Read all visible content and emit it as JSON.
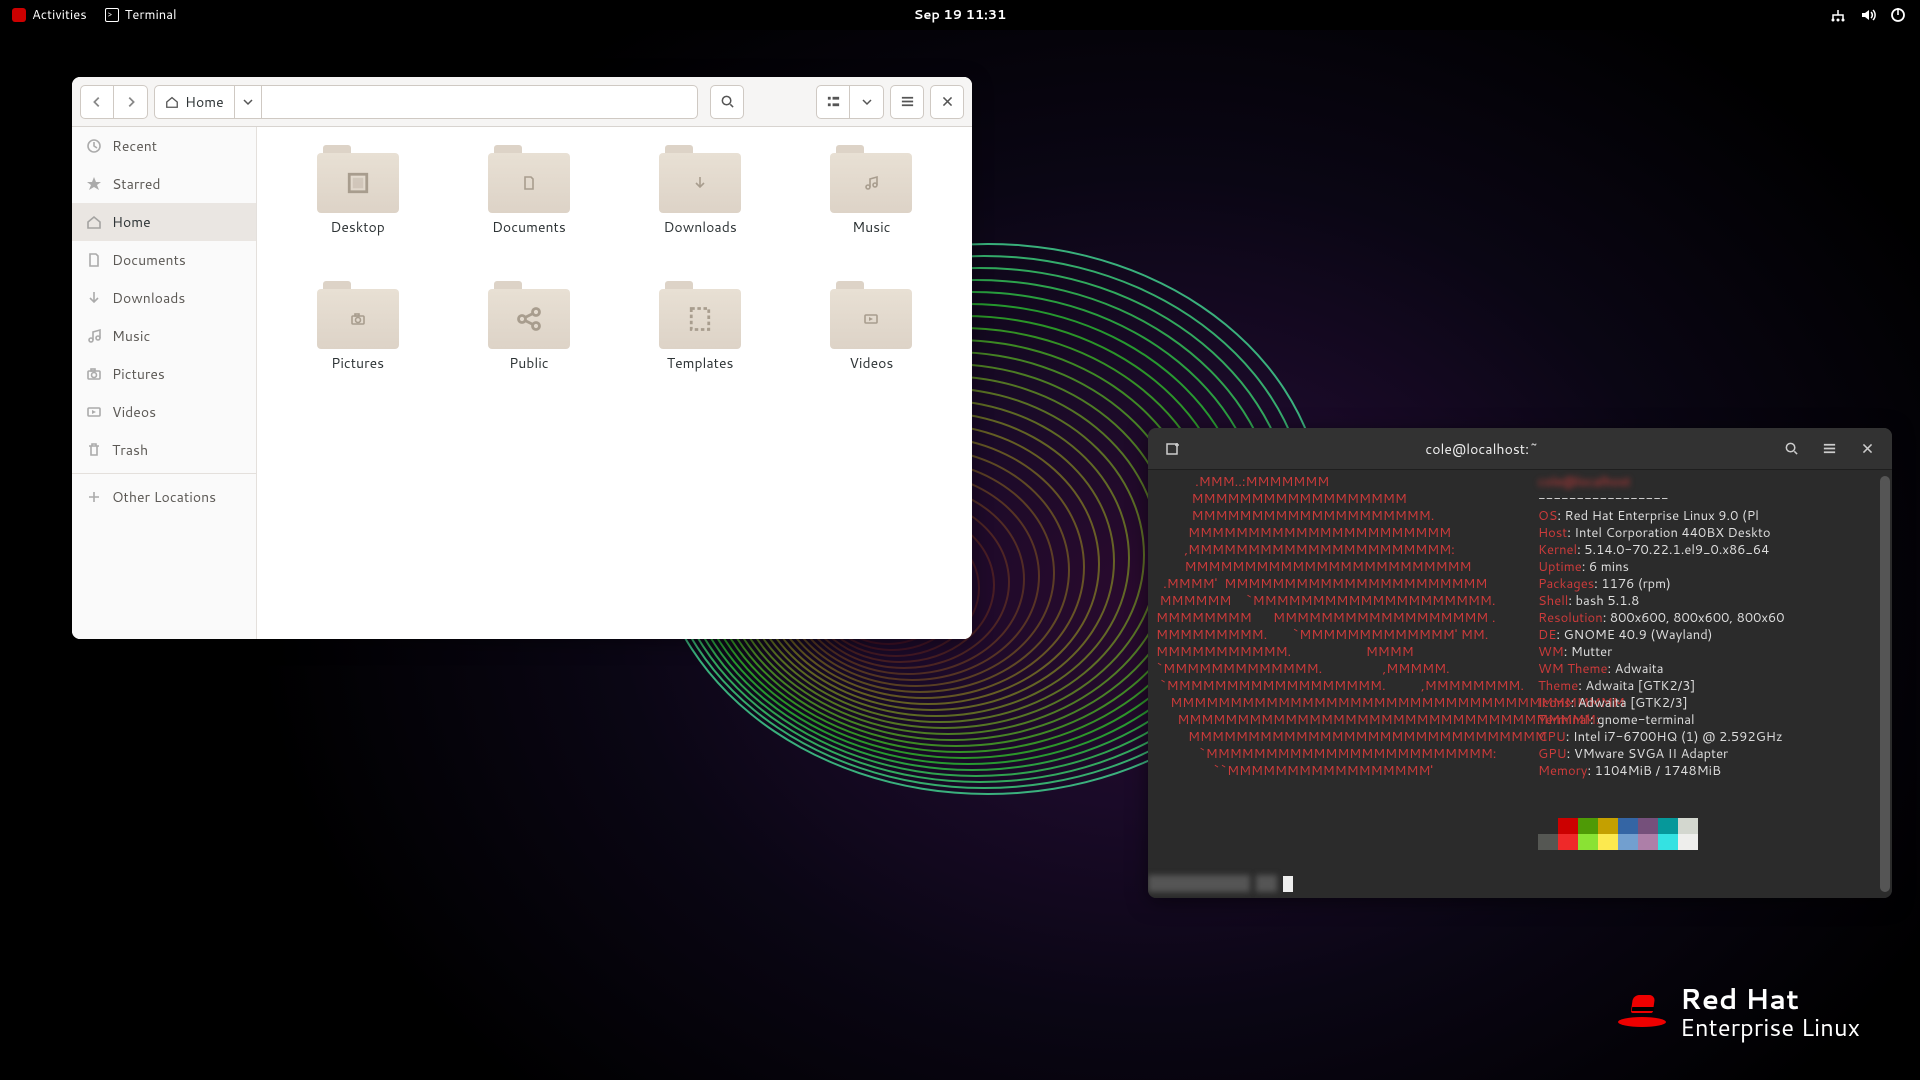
{
  "topbar": {
    "activities": "Activities",
    "terminal_label": "Terminal",
    "datetime": "Sep 19  11:31"
  },
  "files": {
    "path_label": "Home",
    "sidebar": [
      {
        "label": "Recent",
        "icon": "clock"
      },
      {
        "label": "Starred",
        "icon": "star"
      },
      {
        "label": "Home",
        "icon": "home",
        "active": true
      },
      {
        "label": "Documents",
        "icon": "doc"
      },
      {
        "label": "Downloads",
        "icon": "down"
      },
      {
        "label": "Music",
        "icon": "music"
      },
      {
        "label": "Pictures",
        "icon": "camera"
      },
      {
        "label": "Videos",
        "icon": "video"
      },
      {
        "label": "Trash",
        "icon": "trash"
      }
    ],
    "other_locations": "Other Locations",
    "folders": [
      {
        "name": "Desktop",
        "glyph": "desktop"
      },
      {
        "name": "Documents",
        "glyph": "doc"
      },
      {
        "name": "Downloads",
        "glyph": "down"
      },
      {
        "name": "Music",
        "glyph": "music"
      },
      {
        "name": "Pictures",
        "glyph": "camera"
      },
      {
        "name": "Public",
        "glyph": "share"
      },
      {
        "name": "Templates",
        "glyph": "template"
      },
      {
        "name": "Videos",
        "glyph": "video"
      }
    ]
  },
  "terminal": {
    "title": "cole@localhost:~",
    "ascii": [
      "           .MMM..:MMMMMMM",
      "          MMMMMMMMMMMMMMMMMM",
      "          MMMMMMMMMMMMMMMMMMMM.",
      "         MMMMMMMMMMMMMMMMMMMMMM",
      "        ,MMMMMMMMMMMMMMMMMMMMMM:",
      "        MMMMMMMMMMMMMMMMMMMMMMMM",
      "  .MMMM'  MMMMMMMMMMMMMMMMMMMMMM",
      " MMMMMM    `MMMMMMMMMMMMMMMMMMMM.",
      "MMMMMMMM      MMMMMMMMMMMMMMMMMM .",
      "MMMMMMMMM.       `MMMMMMMMMMMMM' MM.",
      "MMMMMMMMMMM.                     MMMM",
      "`MMMMMMMMMMMMM.                 ,MMMMM.",
      " `MMMMMMMMMMMMMMMMMM.          ,MMMMMMMM.",
      "    MMMMMMMMMMMMMMMMMMMMMMMMMMMMMMMMMMMMMM",
      "      MMMMMMMMMMMMMMMMMMMMMMMMMMMMMMMMMMM:",
      "         MMMMMMMMMMMMMMMMMMMMMMMMMMMMMM",
      "            `MMMMMMMMMMMMMMMMMMMMMMMM:",
      "                ``MMMMMMMMMMMMMMMMM'"
    ],
    "info": [
      {
        "k": "",
        "v": "-----------------"
      },
      {
        "k": "OS",
        "v": "Red Hat Enterprise Linux 9.0 (Pl"
      },
      {
        "k": "Host",
        "v": "Intel Corporation 440BX Deskto"
      },
      {
        "k": "Kernel",
        "v": "5.14.0-70.22.1.el9_0.x86_64"
      },
      {
        "k": "Uptime",
        "v": "6 mins"
      },
      {
        "k": "Packages",
        "v": "1176 (rpm)"
      },
      {
        "k": "Shell",
        "v": "bash 5.1.8"
      },
      {
        "k": "Resolution",
        "v": "800x600, 800x600, 800x60"
      },
      {
        "k": "DE",
        "v": "GNOME 40.9 (Wayland)"
      },
      {
        "k": "WM",
        "v": "Mutter"
      },
      {
        "k": "WM Theme",
        "v": "Adwaita"
      },
      {
        "k": "Theme",
        "v": "Adwaita [GTK2/3]"
      },
      {
        "k": "Icons",
        "v": "Adwaita [GTK2/3]"
      },
      {
        "k": "Terminal",
        "v": "gnome-terminal"
      },
      {
        "k": "CPU",
        "v": "Intel i7-6700HQ (1) @ 2.592GHz"
      },
      {
        "k": "GPU",
        "v": "VMware SVGA II Adapter"
      },
      {
        "k": "Memory",
        "v": "1104MiB / 1748MiB"
      }
    ],
    "colors_top": [
      "#2b2b2b",
      "#cc0000",
      "#4e9a06",
      "#c4a000",
      "#3465a4",
      "#75507b",
      "#06989a",
      "#d3d7cf"
    ],
    "colors_bot": [
      "#555753",
      "#ef2929",
      "#8ae234",
      "#fce94f",
      "#729fcf",
      "#ad7fa8",
      "#34e2e2",
      "#eeeeec"
    ]
  },
  "brand": {
    "line1": "Red Hat",
    "line2": "Enterprise Linux"
  }
}
